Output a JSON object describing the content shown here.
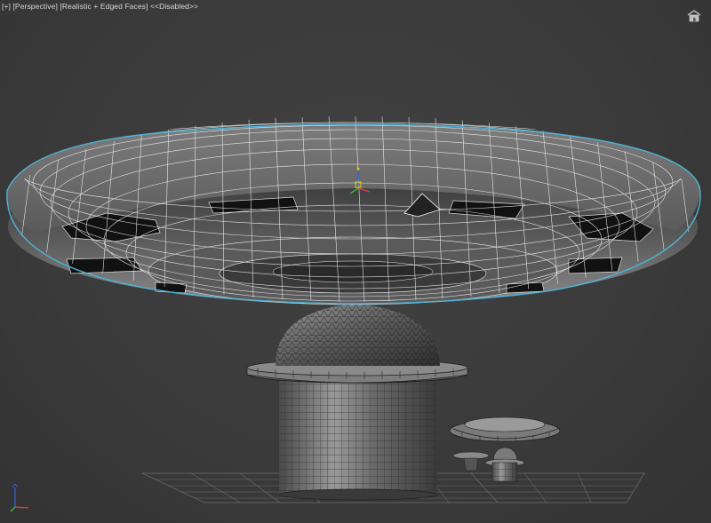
{
  "viewport": {
    "labels": {
      "menu": "[+]",
      "view": "[Perspective]",
      "shading": "[Realistic + Edged Faces]",
      "state": "<<Disabled>>"
    }
  },
  "icons": {
    "viewcube": "home-viewcube-icon",
    "world_axis": "world-axis-tripod-icon",
    "pivot_gizmo": "transform-gizmo-icon"
  },
  "colors": {
    "background": "#3d3d3d",
    "wireframe": "#ffffff",
    "selection_outline": "#4fb3d9",
    "axis_x": "#e04040",
    "axis_y": "#40c040",
    "axis_z": "#3060e0",
    "gizmo_yellow": "#e8d000"
  }
}
